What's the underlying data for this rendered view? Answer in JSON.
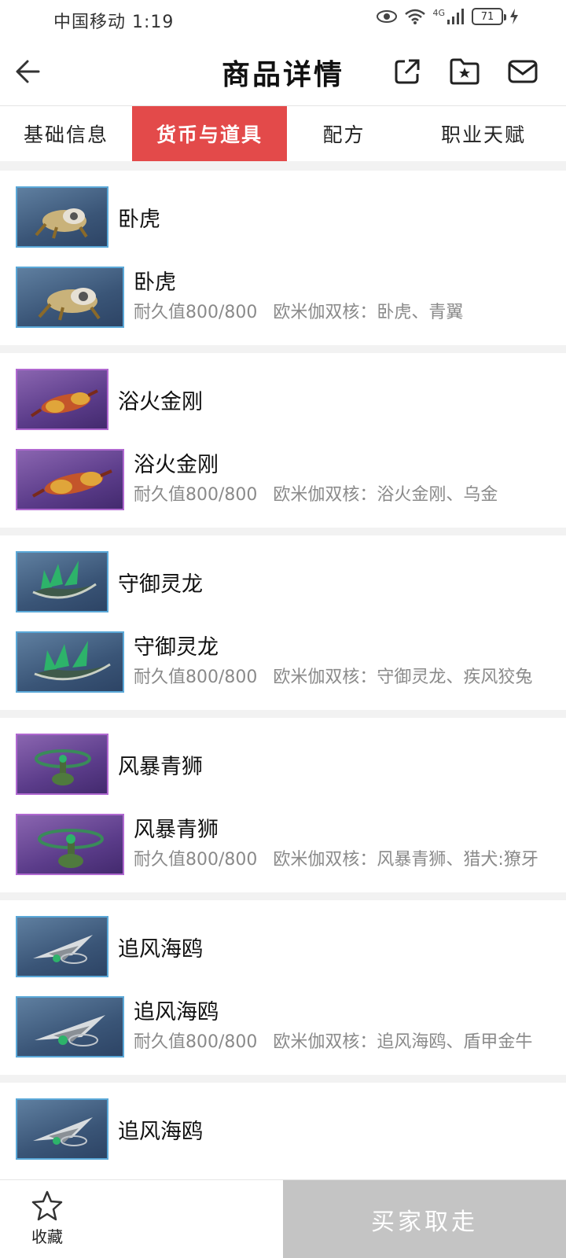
{
  "status_bar": {
    "carrier": "中国移动 1:19",
    "network": "4G",
    "battery": "71"
  },
  "header": {
    "title": "商品详情",
    "icons": [
      "back-arrow-icon",
      "share-icon",
      "folder-star-icon",
      "mail-icon"
    ]
  },
  "tabs": [
    {
      "label": "基础信息",
      "active": false
    },
    {
      "label": "货币与道具",
      "active": true
    },
    {
      "label": "配方",
      "active": false
    },
    {
      "label": "职业天赋",
      "active": false
    }
  ],
  "items": [
    {
      "thumb_color": "blue",
      "title": "卧虎",
      "name": "卧虎",
      "durability": "耐久值800/800",
      "core": "欧米伽双核：卧虎、青翼"
    },
    {
      "thumb_color": "purple",
      "title": "浴火金刚",
      "name": "浴火金刚",
      "durability": "耐久值800/800",
      "core": "欧米伽双核：浴火金刚、乌金"
    },
    {
      "thumb_color": "blue",
      "title": "守御灵龙",
      "name": "守御灵龙",
      "durability": "耐久值800/800",
      "core": "欧米伽双核：守御灵龙、疾风狡兔"
    },
    {
      "thumb_color": "purple",
      "title": "风暴青狮",
      "name": "风暴青狮",
      "durability": "耐久值800/800",
      "core": "欧米伽双核：风暴青狮、猎犬:獠牙"
    },
    {
      "thumb_color": "blue",
      "title": "追风海鸥",
      "name": "追风海鸥",
      "durability": "耐久值800/800",
      "core": "欧米伽双核：追风海鸥、盾甲金牛"
    },
    {
      "thumb_color": "blue",
      "title": "追风海鸥",
      "name": "",
      "durability": "",
      "core": ""
    }
  ],
  "bottom_bar": {
    "favorite_label": "收藏",
    "buy_label": "买家取走"
  },
  "colors": {
    "active_tab": "#e34a4a",
    "buy_button": "#c4c4c4",
    "meta_text": "#8a8a8a"
  }
}
